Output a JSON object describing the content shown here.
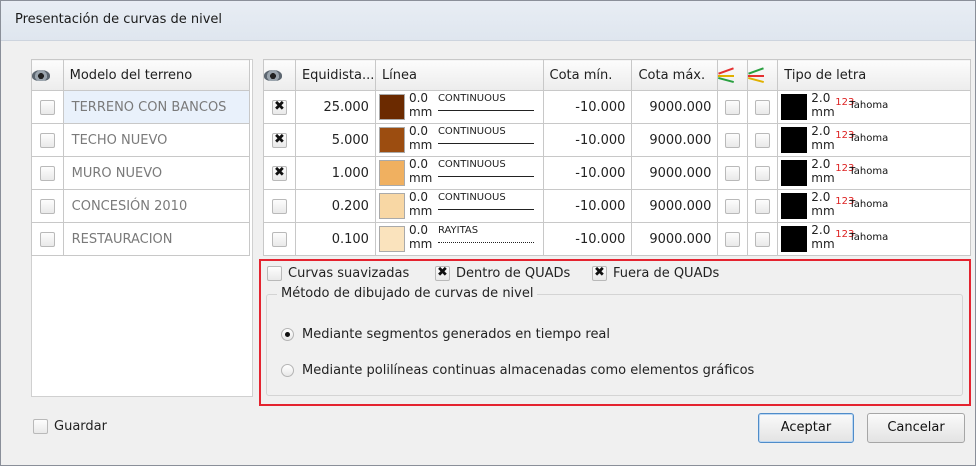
{
  "window": {
    "title": "Presentación de curvas de nivel"
  },
  "models": {
    "header": {
      "icon": "eye-icon",
      "label": "Modelo del terreno"
    },
    "rows": [
      {
        "name": "TERRENO CON BANCOS",
        "selected": true
      },
      {
        "name": "TECHO NUEVO"
      },
      {
        "name": "MURO NUEVO"
      },
      {
        "name": "CONCESIÓN 2010"
      },
      {
        "name": "RESTAURACION"
      }
    ]
  },
  "curves": {
    "headers": {
      "visible_icon": "eye-icon",
      "equidistance": "Equidista...",
      "line": "Línea",
      "cota_min": "Cota mín.",
      "cota_max": "Cota máx.",
      "smooth_icon": "contour-smooth-icon",
      "label_icon": "contour-label-icon",
      "font": "Tipo de letra"
    },
    "rows": [
      {
        "visible": true,
        "equidistance": "25.000",
        "color": "#6b2a00",
        "width": "0.0",
        "unit": "mm",
        "linetype": "CONTINUOUS",
        "min": "-10.000",
        "max": "9000.000",
        "font_size": "2.0",
        "font_unit": "mm",
        "font_name": "Tahoma",
        "font_icon_text": "123"
      },
      {
        "visible": true,
        "equidistance": "5.000",
        "color": "#9c4d10",
        "width": "0.0",
        "unit": "mm",
        "linetype": "CONTINUOUS",
        "min": "-10.000",
        "max": "9000.000",
        "font_size": "2.0",
        "font_unit": "mm",
        "font_name": "Tahoma",
        "font_icon_text": "123"
      },
      {
        "visible": true,
        "equidistance": "1.000",
        "color": "#f0b060",
        "width": "0.0",
        "unit": "mm",
        "linetype": "CONTINUOUS",
        "min": "-10.000",
        "max": "9000.000",
        "font_size": "2.0",
        "font_unit": "mm",
        "font_name": "Tahoma",
        "font_icon_text": "123"
      },
      {
        "visible": false,
        "equidistance": "0.200",
        "color": "#f8d7a4",
        "width": "0.0",
        "unit": "mm",
        "linetype": "CONTINUOUS",
        "min": "-10.000",
        "max": "9000.000",
        "font_size": "2.0",
        "font_unit": "mm",
        "font_name": "Tahoma",
        "font_icon_text": "123"
      },
      {
        "visible": false,
        "equidistance": "0.100",
        "color": "#fae3bd",
        "width": "0.0",
        "unit": "mm",
        "linetype": "RAYITAS",
        "min": "-10.000",
        "max": "9000.000",
        "font_size": "2.0",
        "font_unit": "mm",
        "font_name": "Tahoma",
        "font_icon_text": "123"
      }
    ]
  },
  "options": {
    "smoothed": {
      "label": "Curvas suavizadas",
      "checked": false
    },
    "inside_quads": {
      "label": "Dentro de QUADs",
      "checked": true
    },
    "outside_quads": {
      "label": "Fuera de QUADs",
      "checked": true
    },
    "method_group": {
      "legend": "Método de dibujado de curvas de nivel",
      "option1": "Mediante segmentos generados en tiempo real",
      "option2": "Mediante polilíneas continuas almacenadas como elementos gráficos",
      "selected": 1
    }
  },
  "footer": {
    "save_label": "Guardar",
    "accept_label": "Aceptar",
    "cancel_label": "Cancelar"
  },
  "colors": {
    "highlight_border": "#e4232f",
    "selected_row": "#e9f1fb"
  }
}
